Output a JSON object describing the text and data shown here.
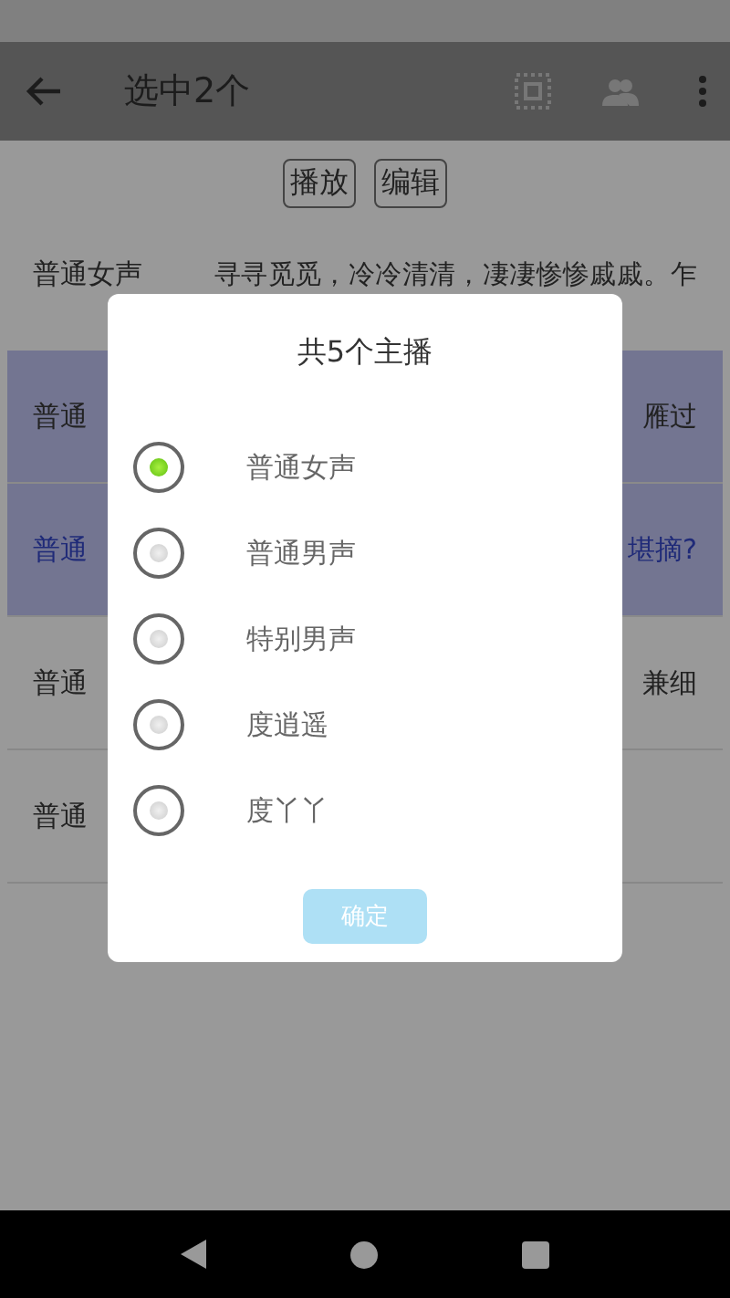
{
  "app_bar": {
    "title": "选中2个"
  },
  "actions": [
    "播放",
    "编辑"
  ],
  "rows": [
    {
      "name": "普通女声",
      "text": "寻寻觅觅，冷冷清清，凄凄惨惨戚戚。乍",
      "selected": false,
      "current": false
    },
    {
      "name": "普通",
      "text": "雁过",
      "selected": true,
      "current": false
    },
    {
      "name": "普通",
      "text": "堪摘?",
      "selected": true,
      "current": true
    },
    {
      "name": "普通",
      "text": "兼细",
      "selected": false,
      "current": false
    },
    {
      "name": "普通",
      "selected": false,
      "current": false
    }
  ],
  "dialog": {
    "title": "共5个主播",
    "options": [
      {
        "label": "普通女声",
        "selected": true
      },
      {
        "label": "普通男声",
        "selected": false
      },
      {
        "label": "特别男声",
        "selected": false
      },
      {
        "label": "度逍遥",
        "selected": false
      },
      {
        "label": "度丫丫",
        "selected": false
      }
    ],
    "confirm": {
      "label": "确定",
      "disabled": true
    }
  }
}
